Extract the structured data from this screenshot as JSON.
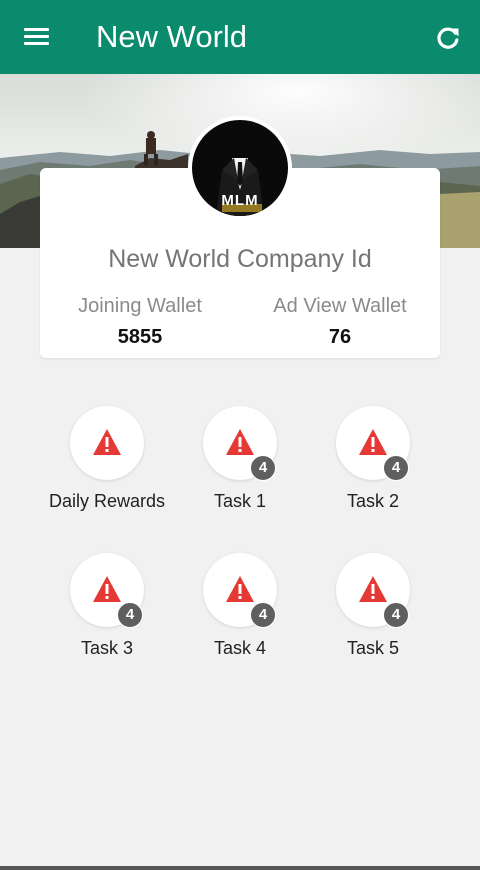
{
  "appbar": {
    "title": "New World",
    "menu_icon": "hamburger-menu-icon",
    "refresh_icon": "refresh-icon",
    "color": "#0b8b6e"
  },
  "profile": {
    "avatar_text": "MLM",
    "company_name": "New World Company Id",
    "wallets": [
      {
        "label": "Joining Wallet",
        "value": "5855"
      },
      {
        "label": "Ad View Wallet",
        "value": "76"
      }
    ]
  },
  "tiles": [
    {
      "label": "Daily Rewards",
      "badge": "",
      "icon": "warning-icon"
    },
    {
      "label": "Task 1",
      "badge": "4",
      "icon": "warning-icon"
    },
    {
      "label": "Task 2",
      "badge": "4",
      "icon": "warning-icon"
    },
    {
      "label": "Task 3",
      "badge": "4",
      "icon": "warning-icon"
    },
    {
      "label": "Task 4",
      "badge": "4",
      "icon": "warning-icon"
    },
    {
      "label": "Task 5",
      "badge": "4",
      "icon": "warning-icon"
    }
  ],
  "colors": {
    "warning": "#e53935",
    "badge": "#5f5f5f"
  }
}
